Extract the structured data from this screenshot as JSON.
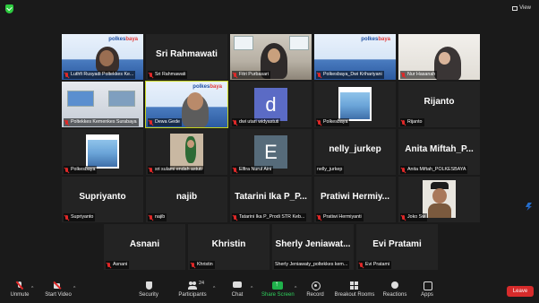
{
  "window": {
    "view_label": "View"
  },
  "rows": [
    [
      {
        "name": "Luthfi Rusyadi Poltekkes Ke...",
        "kind": "video"
      },
      {
        "name": "Sri Rahmawati",
        "kind": "name",
        "bigname": "Sri Rahmawati"
      },
      {
        "name": "Fitri Purbasari",
        "kind": "video"
      },
      {
        "name": "Polkesbaya_Dwi Krihariyani",
        "kind": "video"
      },
      {
        "name": "Nur Hasanah",
        "kind": "video"
      }
    ],
    [
      {
        "name": "Poltekkes Kemenkes Surabaya",
        "kind": "video"
      },
      {
        "name": "Dewa Gede",
        "kind": "video",
        "active": true
      },
      {
        "name": "dwi utari widyastuti",
        "kind": "letter",
        "letter": "d"
      },
      {
        "name": "Polkesbaya",
        "kind": "video"
      },
      {
        "name": "Rijanto",
        "kind": "name",
        "bigname": "Rijanto"
      }
    ],
    [
      {
        "name": "Polkesbaya",
        "kind": "video"
      },
      {
        "name": "sri sulami endah astuti",
        "kind": "video"
      },
      {
        "name": "Elfira Nurul Aini",
        "kind": "letter",
        "letter": "E"
      },
      {
        "name": "nelly_jurkep",
        "kind": "name",
        "bigname": "nelly_jurkep",
        "muted": false
      },
      {
        "name": "Anita Miftah_POLKESBAYA",
        "kind": "name",
        "bigname": "Anita Miftah_P..."
      }
    ],
    [
      {
        "name": "Supriyanto",
        "kind": "name",
        "bigname": "Supriyanto"
      },
      {
        "name": "najib",
        "kind": "name",
        "bigname": "najib"
      },
      {
        "name": "Tatarini Ika P_Prodi STR Keb...",
        "kind": "name",
        "bigname": "Tatarini Ika P_P..."
      },
      {
        "name": "Pratiwi Hermiyanti",
        "kind": "name",
        "bigname": "Pratiwi Hermiy..."
      },
      {
        "name": "Joko Sw",
        "kind": "video"
      }
    ],
    [
      {
        "name": "Asnani",
        "kind": "name",
        "bigname": "Asnani"
      },
      {
        "name": "Khristin",
        "kind": "name",
        "bigname": "Khristin"
      },
      {
        "name": "Sherly Jeniawaty_poltekkes kem...",
        "kind": "name",
        "bigname": "Sherly Jeniawat...",
        "muted": false
      },
      {
        "name": "Evi Pratami",
        "kind": "name",
        "bigname": "Evi Pratami"
      }
    ]
  ],
  "toolbar": {
    "unmute": "Unmute",
    "start_video": "Start Video",
    "security": "Security",
    "participants": "Participants",
    "participants_count": "24",
    "chat": "Chat",
    "share_screen": "Share Screen",
    "record": "Record",
    "breakout_rooms": "Breakout Rooms",
    "reactions": "Reactions",
    "apps": "Apps",
    "leave": "Leave"
  },
  "colors": {
    "active_speaker": "#c7d41e",
    "leave": "#d72b2b",
    "share": "#1fb14b",
    "muted": "#e02828"
  }
}
